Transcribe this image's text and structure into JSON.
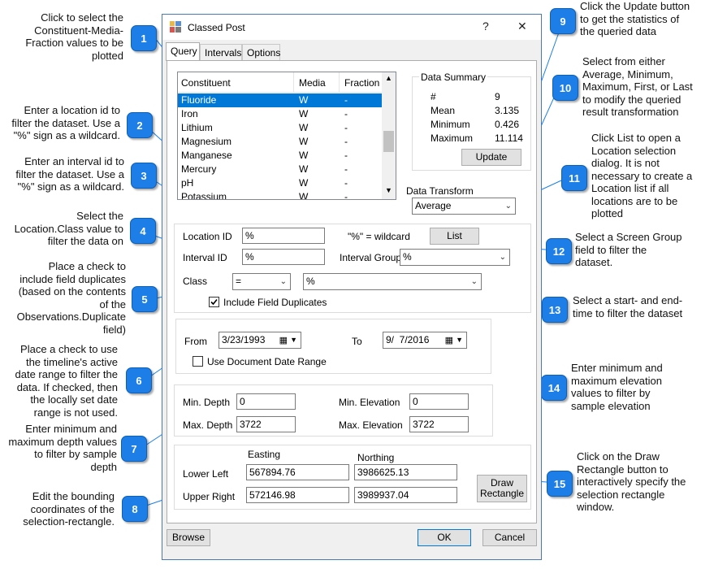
{
  "window": {
    "title": "Classed Post",
    "help_glyph": "?",
    "close_glyph": "✕",
    "tabs": [
      "Query",
      "Intervals",
      "Options"
    ]
  },
  "constituent_list": {
    "headers": [
      "Constituent",
      "Media",
      "Fraction"
    ],
    "rows": [
      {
        "constituent": "Fluoride",
        "media": "W",
        "fraction": "-",
        "selected": true
      },
      {
        "constituent": "Iron",
        "media": "W",
        "fraction": "-"
      },
      {
        "constituent": "Lithium",
        "media": "W",
        "fraction": "-"
      },
      {
        "constituent": "Magnesium",
        "media": "W",
        "fraction": "-"
      },
      {
        "constituent": "Manganese",
        "media": "W",
        "fraction": "-"
      },
      {
        "constituent": "Mercury",
        "media": "W",
        "fraction": "-"
      },
      {
        "constituent": "pH",
        "media": "W",
        "fraction": "-"
      },
      {
        "constituent": "Potassium",
        "media": "W",
        "fraction": "-"
      }
    ]
  },
  "data_summary": {
    "title": "Data Summary",
    "rows": [
      {
        "label": "#",
        "value": "9"
      },
      {
        "label": "Mean",
        "value": "3.135"
      },
      {
        "label": "Minimum",
        "value": "0.426"
      },
      {
        "label": "Maximum",
        "value": "11.114"
      }
    ],
    "update_label": "Update"
  },
  "data_transform": {
    "label": "Data Transform",
    "value": "Average"
  },
  "location": {
    "location_id_label": "Location ID",
    "location_id_value": "%",
    "wildcard_hint": "\"%\" = wildcard",
    "list_label": "List",
    "interval_id_label": "Interval ID",
    "interval_id_value": "%",
    "interval_group_label": "Interval Group",
    "interval_group_value": "%",
    "class_label": "Class",
    "class_op_value": "=",
    "class_value": "%",
    "include_dup_label": "Include Field Duplicates",
    "include_dup_checked": true
  },
  "dates": {
    "from_label": "From",
    "from_value": "3/23/1993",
    "to_label": "To",
    "to_value": "9/  7/2016",
    "use_doc_range_label": "Use Document Date Range",
    "use_doc_range_checked": false
  },
  "depth": {
    "min_depth_label": "Min. Depth",
    "min_depth_value": "0",
    "max_depth_label": "Max. Depth",
    "max_depth_value": "3722",
    "min_elev_label": "Min. Elevation",
    "min_elev_value": "0",
    "max_elev_label": "Max. Elevation",
    "max_elev_value": "3722"
  },
  "bounds": {
    "easting_label": "Easting",
    "northing_label": "Northing",
    "lower_left_label": "Lower Left",
    "lower_left_easting": "567894.76",
    "lower_left_northing": "3986625.13",
    "upper_right_label": "Upper Right",
    "upper_right_easting": "572146.98",
    "upper_right_northing": "3989937.04",
    "draw_rect_label_1": "Draw",
    "draw_rect_label_2": "Rectangle"
  },
  "footer": {
    "browse_label": "Browse",
    "ok_label": "OK",
    "cancel_label": "Cancel"
  },
  "callouts": [
    {
      "num": "1",
      "text": "Click to select the\nConstituent-Media-\nFraction values to be\nplotted"
    },
    {
      "num": "2",
      "text": "Enter a location id to\nfilter the dataset.  Use a\n\"%\" sign as a wildcard."
    },
    {
      "num": "3",
      "text": "Enter an interval id to\nfilter the dataset.  Use a\n\"%\" sign as a wildcard."
    },
    {
      "num": "4",
      "text": "Select the\nLocation.Class value to\nfilter the data on"
    },
    {
      "num": "5",
      "text": "Place a check to\ninclude field duplicates\n(based on the contents\nof the\nObservations.Duplicate\nfield)"
    },
    {
      "num": "6",
      "text": "Place a check to use\nthe timeline's active\ndate range to filter the\ndata.  If checked, then\nthe locally set date\nrange is not used."
    },
    {
      "num": "7",
      "text": "Enter minimum and\nmaximum depth values\nto filter by sample\ndepth"
    },
    {
      "num": "8",
      "text": "Edit the bounding\ncoordinates of the\nselection-rectangle."
    },
    {
      "num": "9",
      "text": "Click the Update button\nto get the statistics of\nthe queried data"
    },
    {
      "num": "10",
      "text": "Select from either\nAverage, Minimum,\nMaximum, First, or Last\nto modify the queried\nresult transformation"
    },
    {
      "num": "11",
      "text": "Click List to open a\nLocation selection\ndialog.  It is not\nnecessary to create a\nLocation list if all\nlocations are to be\nplotted"
    },
    {
      "num": "12",
      "text": "Select a Screen Group\nfield to filter the\ndataset."
    },
    {
      "num": "13",
      "text": "Select a start- and end-\ntime to filter the dataset"
    },
    {
      "num": "14",
      "text": "Enter minimum and\nmaximum elevation\nvalues to filter by\nsample elevation"
    },
    {
      "num": "15",
      "text": "Click on the Draw\nRectangle button to\ninteractively specify the\nselection rectangle\nwindow."
    }
  ]
}
